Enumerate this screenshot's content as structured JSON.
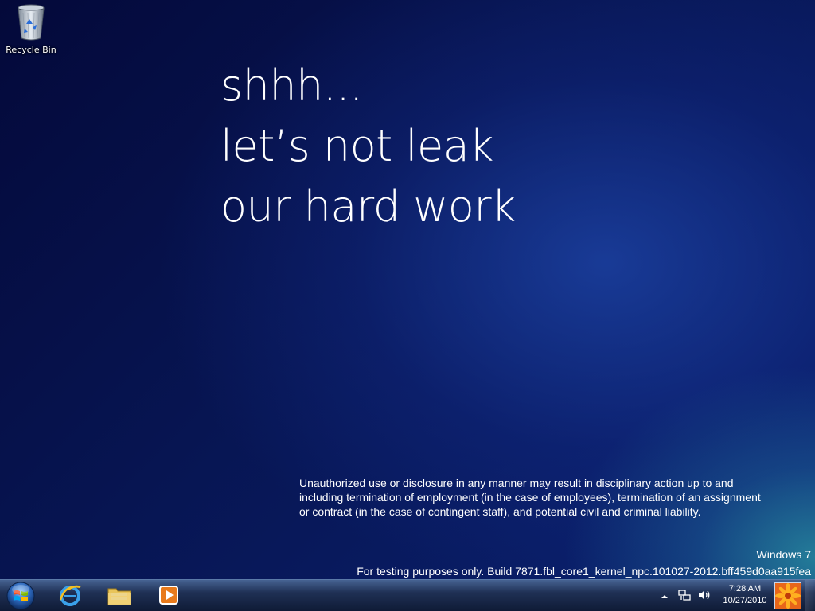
{
  "desktop": {
    "icons": [
      {
        "label": "Recycle Bin",
        "icon": "recycle-bin-icon"
      }
    ]
  },
  "wallpaper": {
    "headline": [
      "shhh...",
      "let’s not leak",
      "our hard work"
    ],
    "legal": [
      "Unauthorized use or disclosure in any manner may result in disciplinary action up to and",
      "including termination of employment (in the case of employees), termination of an assignment",
      "or contract (in the case of contingent staff), and potential civil and criminal liability."
    ]
  },
  "watermark": {
    "os_name": "Windows 7",
    "build_text": "For testing purposes only. Build 7871.fbl_core1_kernel_npc.101027-2012.bff459d0aa915fea"
  },
  "taskbar": {
    "start": {
      "icon": "windows-start-orb-icon"
    },
    "pinned": [
      {
        "icon": "internet-explorer-icon"
      },
      {
        "icon": "windows-explorer-icon"
      },
      {
        "icon": "media-player-icon"
      }
    ],
    "tray": {
      "icons": [
        "show-hidden-icons-arrow-icon",
        "network-icon",
        "volume-icon"
      ],
      "time": "7:28 AM",
      "date": "10/27/2010"
    }
  },
  "colors": {
    "desktop_dark": "#04093a",
    "desktop_mid": "#0a2170",
    "desktop_teal": "#288ca0",
    "text": "#ffffff",
    "taskbar": "#162850"
  }
}
